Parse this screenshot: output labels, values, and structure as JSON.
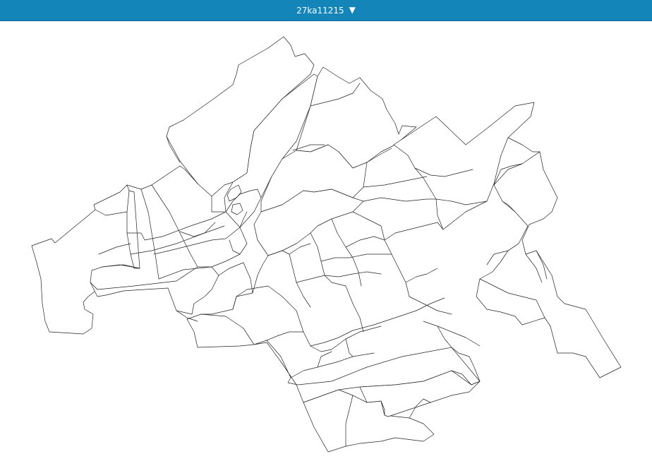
{
  "header": {
    "selector_label": "27ka11215",
    "caret_icon": "triangle-down-icon",
    "background_color": "#1385b9",
    "text_color": "#ffffff"
  },
  "map": {
    "fill_color": "#ffffff",
    "stroke_color": "#222222"
  }
}
